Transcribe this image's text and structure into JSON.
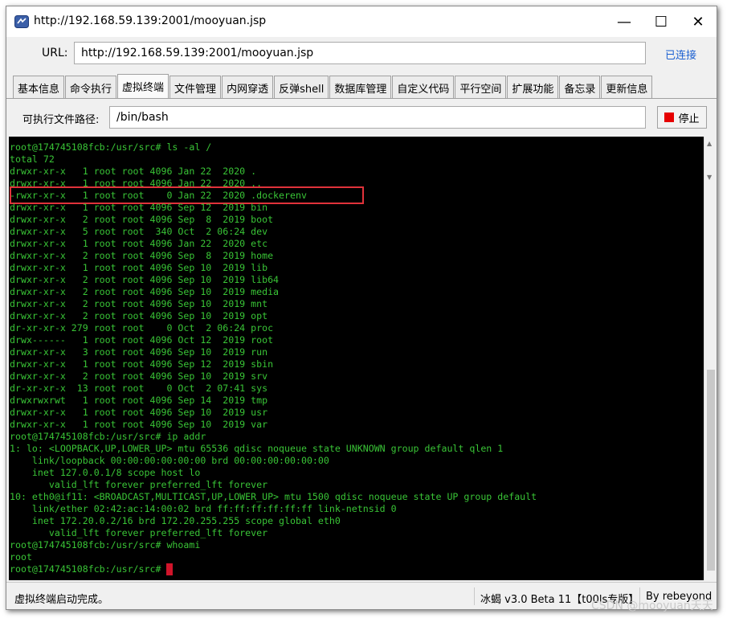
{
  "window": {
    "title": "http://192.168.59.139:2001/mooyuan.jsp",
    "minimize_glyph": "—",
    "maximize_glyph": "☐",
    "close_glyph": "✕"
  },
  "url_bar": {
    "label": "URL:",
    "value": "http://192.168.59.139:2001/mooyuan.jsp",
    "status": "已连接"
  },
  "tabs": [
    {
      "label": "基本信息"
    },
    {
      "label": "命令执行"
    },
    {
      "label": "虚拟终端",
      "active": true
    },
    {
      "label": "文件管理"
    },
    {
      "label": "内网穿透"
    },
    {
      "label": "反弹shell"
    },
    {
      "label": "数据库管理"
    },
    {
      "label": "自定义代码"
    },
    {
      "label": "平行空间"
    },
    {
      "label": "扩展功能"
    },
    {
      "label": "备忘录"
    },
    {
      "label": "更新信息"
    }
  ],
  "exec_path": {
    "label": "可执行文件路径:",
    "value": "/bin/bash"
  },
  "stop_button": {
    "label": "停止",
    "color": "#e60000"
  },
  "terminal": {
    "text_color": "#39c436",
    "background": "#000000",
    "highlight_color": "#e0323a",
    "lines": [
      "root@174745108fcb:/usr/src# ls -al /",
      "total 72",
      "drwxr-xr-x   1 root root 4096 Jan 22  2020 .",
      "drwxr-xr-x   1 root root 4096 Jan 22  2020 ..",
      "-rwxr-xr-x   1 root root    0 Jan 22  2020 .dockerenv",
      "drwxr-xr-x   1 root root 4096 Sep 12  2019 bin",
      "drwxr-xr-x   2 root root 4096 Sep  8  2019 boot",
      "drwxr-xr-x   5 root root  340 Oct  2 06:24 dev",
      "drwxr-xr-x   1 root root 4096 Jan 22  2020 etc",
      "drwxr-xr-x   2 root root 4096 Sep  8  2019 home",
      "drwxr-xr-x   1 root root 4096 Sep 10  2019 lib",
      "drwxr-xr-x   2 root root 4096 Sep 10  2019 lib64",
      "drwxr-xr-x   2 root root 4096 Sep 10  2019 media",
      "drwxr-xr-x   2 root root 4096 Sep 10  2019 mnt",
      "drwxr-xr-x   2 root root 4096 Sep 10  2019 opt",
      "dr-xr-xr-x 279 root root    0 Oct  2 06:24 proc",
      "drwx------   1 root root 4096 Oct 12  2019 root",
      "drwxr-xr-x   3 root root 4096 Sep 10  2019 run",
      "drwxr-xr-x   1 root root 4096 Sep 12  2019 sbin",
      "drwxr-xr-x   2 root root 4096 Sep 10  2019 srv",
      "dr-xr-xr-x  13 root root    0 Oct  2 07:41 sys",
      "drwxrwxrwt   1 root root 4096 Sep 14  2019 tmp",
      "drwxr-xr-x   1 root root 4096 Sep 10  2019 usr",
      "drwxr-xr-x   1 root root 4096 Sep 10  2019 var",
      "root@174745108fcb:/usr/src# ip addr",
      "1: lo: <LOOPBACK,UP,LOWER_UP> mtu 65536 qdisc noqueue state UNKNOWN group default qlen 1",
      "    link/loopback 00:00:00:00:00:00 brd 00:00:00:00:00:00",
      "    inet 127.0.0.1/8 scope host lo",
      "       valid_lft forever preferred_lft forever",
      "10: eth0@if11: <BROADCAST,MULTICAST,UP,LOWER_UP> mtu 1500 qdisc noqueue state UP group default",
      "    link/ether 02:42:ac:14:00:02 brd ff:ff:ff:ff:ff:ff link-netnsid 0",
      "    inet 172.20.0.2/16 brd 172.20.255.255 scope global eth0",
      "       valid_lft forever preferred_lft forever",
      "root@174745108fcb:/usr/src# whoami",
      "root",
      "root@174745108fcb:/usr/src# "
    ],
    "highlighted_line_index": 4
  },
  "status_bar": {
    "left_text": "虚拟终端启动完成。",
    "version_text": "冰蝎 v3.0 Beta 11【t00ls专版】",
    "author_text": "By rebeyond"
  },
  "watermark": "CSDN @mooyuan天天"
}
